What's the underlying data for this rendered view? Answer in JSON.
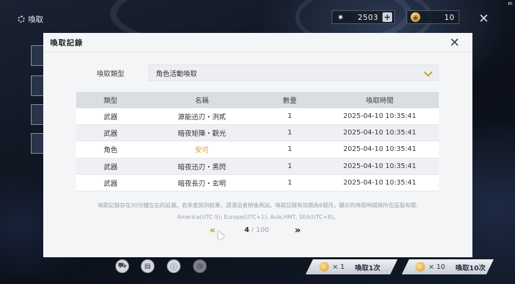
{
  "screen": {
    "title": "喚取",
    "fps": "60",
    "currency": [
      {
        "icon": "star-icon",
        "value": "2503"
      },
      {
        "icon": "coin-icon",
        "value": "10"
      }
    ]
  },
  "dialog": {
    "title": "喚取記錄",
    "filter": {
      "label": "喚取類型",
      "selected": "角色活動喚取"
    },
    "table": {
      "headers": [
        "類型",
        "名稱",
        "數量",
        "喚取時間"
      ],
      "rows": [
        {
          "type": "武器",
          "name": "源能迅刃・洌貳",
          "qty": "1",
          "time": "2025-04-10 10:35:41",
          "highlight": false
        },
        {
          "type": "武器",
          "name": "暗夜矩陣・觀光",
          "qty": "1",
          "time": "2025-04-10 10:35:41",
          "highlight": false
        },
        {
          "type": "角色",
          "name": "安可",
          "qty": "1",
          "time": "2025-04-10 10:35:41",
          "highlight": true
        },
        {
          "type": "武器",
          "name": "暗夜迅刃・黑閃",
          "qty": "1",
          "time": "2025-04-10 10:35:41",
          "highlight": false
        },
        {
          "type": "武器",
          "name": "暗夜長刃・玄明",
          "qty": "1",
          "time": "2025-04-10 10:35:41",
          "highlight": false
        }
      ]
    },
    "note_line1": "喚取記錄存在30分鐘左右的延遲。若未查詢到結果，請漂泊者稍後再試。喚取記錄有效期為6個月，顯示的喚取時間與所在區服有關:",
    "note_line2": "America(UTC-5); Europe(UTC+1); Asia,HMT, SEA(UTC+8)。",
    "pager": {
      "current": "4",
      "separator": "/",
      "total": "100"
    }
  },
  "bottom": {
    "draw_one": {
      "count": "× 1",
      "label": "喚取1次"
    },
    "draw_ten": {
      "count": "× 10",
      "label": "喚取10次"
    }
  },
  "colors": {
    "accent_gold": "#d9a02a",
    "dialog_bg": "#f4f5f7"
  }
}
